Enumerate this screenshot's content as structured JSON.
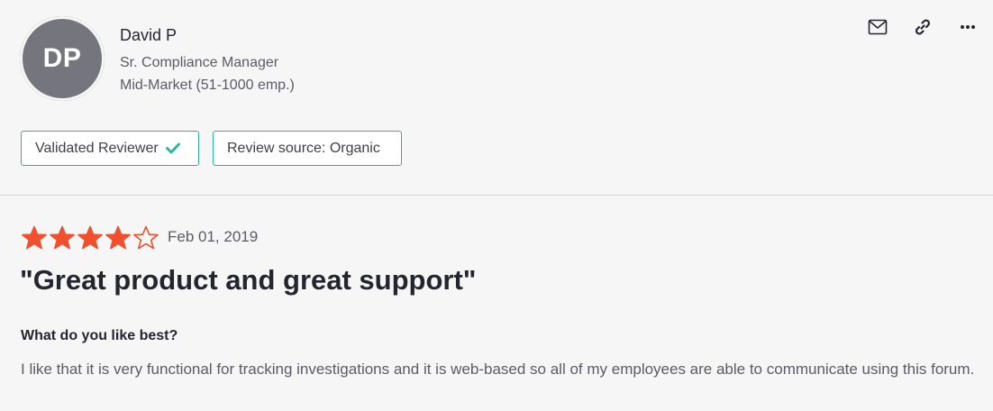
{
  "reviewer": {
    "initials": "DP",
    "name": "David P",
    "title": "Sr. Compliance Manager",
    "company_size": "Mid-Market (51-1000 emp.)"
  },
  "actions": {
    "icons": [
      "mail-icon",
      "link-icon",
      "more-icon"
    ]
  },
  "badges": {
    "validated_label": "Validated Reviewer",
    "source_label": "Review source: Organic"
  },
  "review": {
    "rating": 4,
    "max_rating": 5,
    "date": "Feb 01, 2019",
    "title": "\"Great product and great support\"",
    "question": "What do you like best?",
    "answer": "I like that it is very functional for tracking investigations and it is web-based so all of my employees are able to communicate using this forum."
  },
  "colors": {
    "star": "#f1502f",
    "accent": "#27b4a2",
    "avatar_bg": "#75757d"
  }
}
